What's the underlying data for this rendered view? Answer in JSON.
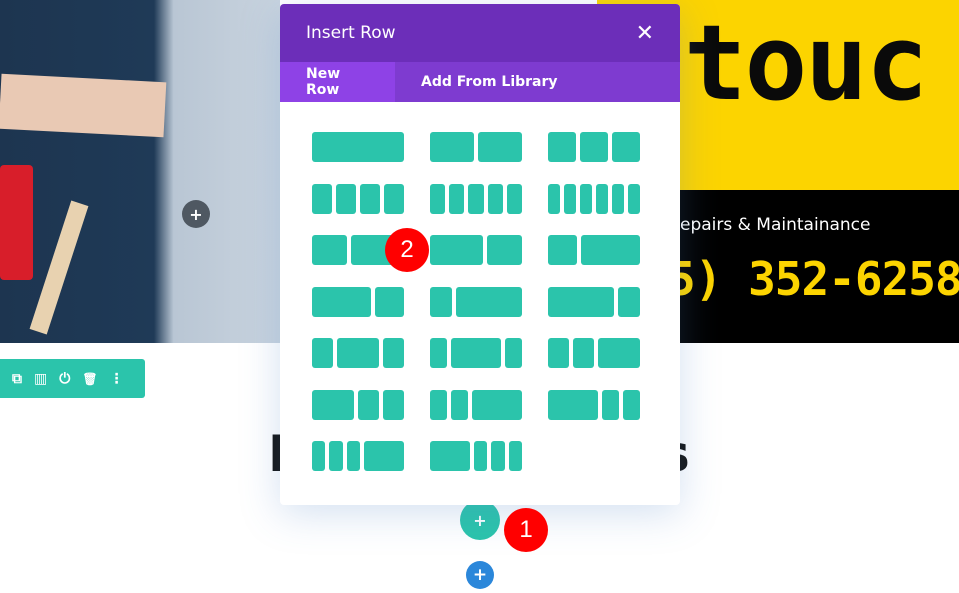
{
  "background": {
    "hero_text": "touc",
    "services_text": "epairs & Maintainance",
    "phone_text": "5) 352-6258",
    "heading_left": "H",
    "heading_right": "s"
  },
  "row_toolbar": {
    "icons": [
      "duplicate-icon",
      "columns-icon",
      "save-icon",
      "trash-icon",
      "more-icon"
    ],
    "glyphs": [
      "⧉",
      "▥",
      "⏻",
      "🗑",
      "⋮"
    ]
  },
  "add_buttons": {
    "plus": "+"
  },
  "modal": {
    "title": "Insert Row",
    "close": "✕",
    "tabs": [
      {
        "label": "New Row",
        "active": true
      },
      {
        "label": "Add From Library",
        "active": false
      }
    ],
    "layouts": [
      [
        1
      ],
      [
        1,
        1
      ],
      [
        1,
        1,
        1
      ],
      [
        1,
        1,
        1,
        1
      ],
      [
        1,
        1,
        1,
        1,
        1
      ],
      [
        1,
        1,
        1,
        1,
        1,
        1
      ],
      [
        2,
        3
      ],
      [
        3,
        2
      ],
      [
        1,
        2
      ],
      [
        2,
        1
      ],
      [
        1,
        3
      ],
      [
        3,
        1
      ],
      [
        1,
        2,
        1
      ],
      [
        1,
        3,
        1
      ],
      [
        1,
        1,
        2
      ],
      [
        2,
        1,
        1
      ],
      [
        1,
        1,
        3
      ],
      [
        3,
        1,
        1
      ],
      [
        1,
        1,
        1,
        3
      ],
      [
        3,
        1,
        1,
        1
      ]
    ]
  },
  "annotations": [
    "1",
    "2"
  ],
  "colors": {
    "accent": "#2bc4ab",
    "modal_header": "#6c2eb9",
    "tab_bar": "#7e3bd0",
    "tab_active": "#8e42e6",
    "badge": "#ff0000",
    "blue_button": "#2b87da"
  }
}
